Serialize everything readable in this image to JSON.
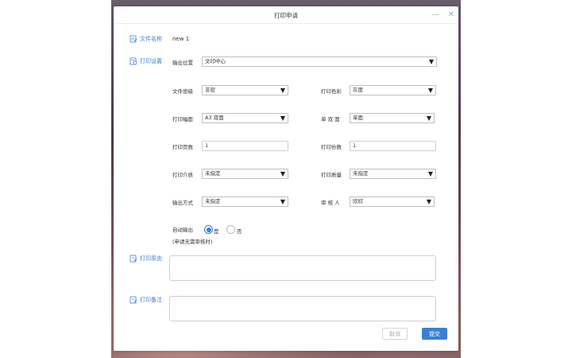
{
  "dialog": {
    "title": "打印申请",
    "minimize_glyph": "—",
    "close_glyph": "✕"
  },
  "file_name": {
    "label": "文件名称",
    "value": "new 1",
    "icon": "edit-doc-icon"
  },
  "print_settings": {
    "label": "打印设置",
    "icon": "settings-doc-icon",
    "output_location": {
      "label": "输出位置",
      "value": "文印中心"
    },
    "security_level": {
      "label": "文件密级",
      "value": "非密"
    },
    "color": {
      "label": "打印色彩",
      "value": "灰度"
    },
    "paper_size": {
      "label": "打印幅面",
      "value": "A3 双面"
    },
    "duplex": {
      "label": "单 双 面",
      "value": "单面"
    },
    "pages": {
      "label": "打印页数",
      "value": "1"
    },
    "copies": {
      "label": "打印份数",
      "value": "1"
    },
    "media": {
      "label": "打印介质",
      "value": "未指定"
    },
    "quality": {
      "label": "打印质量",
      "value": "未指定"
    },
    "output_method": {
      "label": "输出方式",
      "value": "未指定"
    },
    "reviewer": {
      "label": "审 核 人",
      "value": "欣欣"
    },
    "auto_output": {
      "label": "自动输出",
      "note": "(申请无需审核时)",
      "yes": "是",
      "no": "否",
      "selected": "是"
    }
  },
  "reason": {
    "label": "打印原由",
    "icon": "edit-doc-icon",
    "value": ""
  },
  "remarks": {
    "label": "打印备注",
    "icon": "edit-doc-icon",
    "value": ""
  },
  "buttons": {
    "cancel": "取消",
    "submit": "提交"
  },
  "colors": {
    "accent": "#3b7fd4"
  }
}
